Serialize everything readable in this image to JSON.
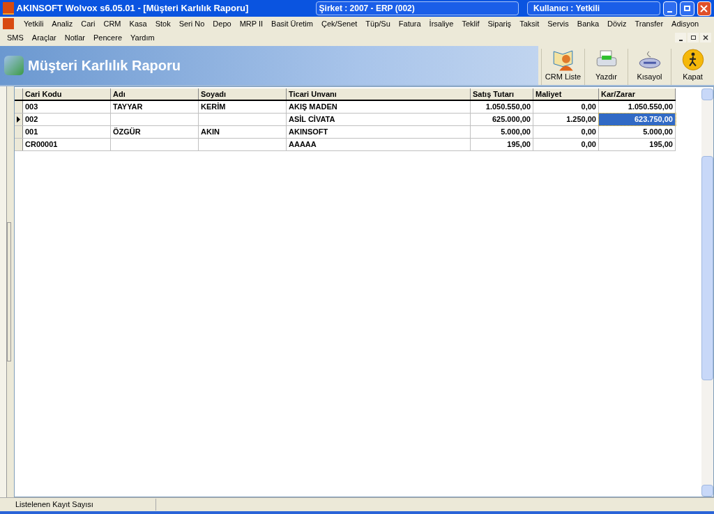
{
  "window": {
    "title": "AKINSOFT Wolvox s6.05.01 - [Müşteri Karlılık Raporu]",
    "company": "Şirket : 2007 - ERP (002)",
    "user": "Kullanıcı : Yetkili"
  },
  "menu": {
    "row_1": [
      "Yetkili",
      "Analiz",
      "Cari",
      "CRM",
      "Kasa",
      "Stok",
      "Seri No",
      "Depo",
      "MRP II",
      "Basit Üretim",
      "Çek/Senet",
      "Tüp/Su",
      "Fatura",
      "İrsaliye",
      "Teklif",
      "Sipariş",
      "Taksit",
      "Servis",
      "Banka",
      "Döviz",
      "Transfer",
      "Adisyon"
    ],
    "row_2": [
      "SMS",
      "Araçlar",
      "Notlar",
      "Pencere",
      "Yardım"
    ]
  },
  "header": {
    "title": "Müşteri Karlılık Raporu",
    "tools": [
      {
        "kind": "crm",
        "label": "CRM Liste"
      },
      {
        "kind": "print",
        "label": "Yazdır"
      },
      {
        "kind": "keyboard",
        "label": "Kısayol"
      },
      {
        "kind": "exit",
        "label": "Kapat"
      }
    ]
  },
  "table": {
    "columns": [
      "Cari Kodu",
      "Adı",
      "Soyadı",
      "Ticari Unvanı",
      "Satış Tutarı",
      "Maliyet",
      "Kar/Zarar"
    ],
    "rows": [
      {
        "selected": false,
        "cells": [
          "003",
          "TAYYAR",
          "KERİM",
          "AKIŞ MADEN",
          "1.050.550,00",
          "0,00",
          "1.050.550,00"
        ]
      },
      {
        "selected": true,
        "cells": [
          "002",
          "",
          "",
          "ASİL CİVATA",
          "625.000,00",
          "1.250,00",
          "623.750,00"
        ]
      },
      {
        "selected": false,
        "cells": [
          "001",
          "ÖZGÜR",
          "AKIN",
          "AKINSOFT",
          "5.000,00",
          "0,00",
          "5.000,00"
        ]
      },
      {
        "selected": false,
        "cells": [
          "CR00001",
          "",
          "",
          "AAAAA",
          "195,00",
          "0,00",
          "195,00"
        ]
      }
    ]
  },
  "status_bar": {
    "label": "Listelenen Kayıt Sayısı"
  }
}
